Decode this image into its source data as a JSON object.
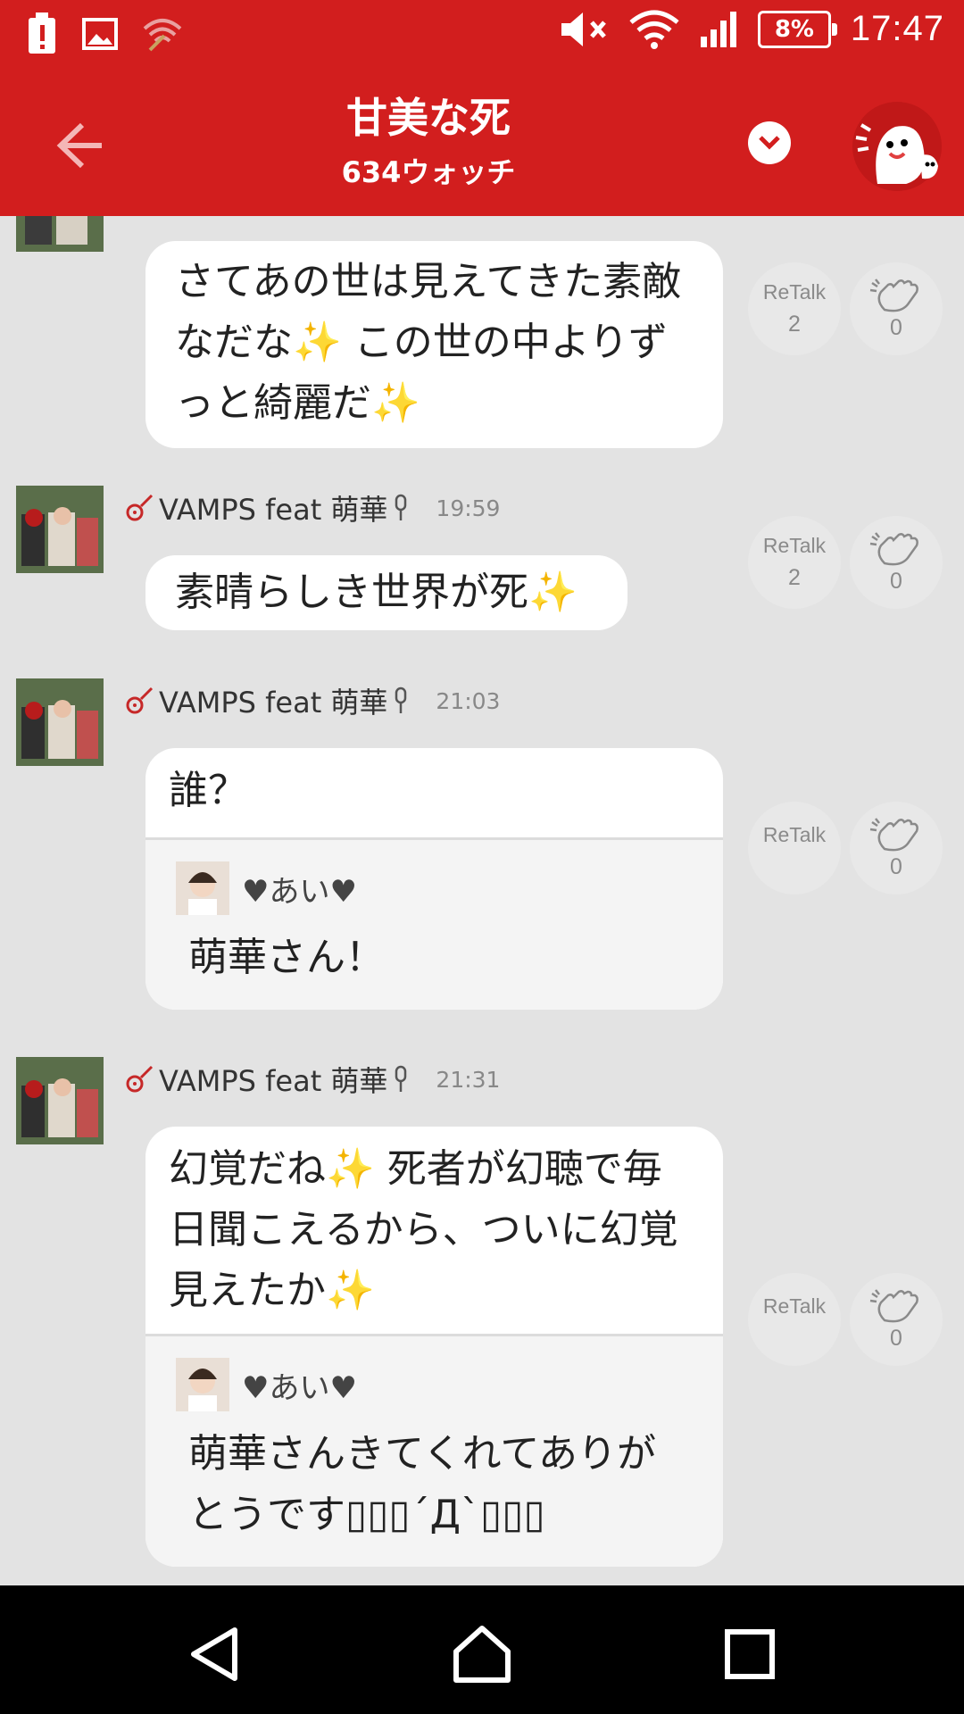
{
  "status_bar": {
    "battery": "8%",
    "time": "17:47"
  },
  "app_bar": {
    "title": "甘美な死",
    "subtitle": "634ウォッチ"
  },
  "messages": [
    {
      "sender": "",
      "time": "",
      "text": "さてあの世は見えてきた素敵なだな✨ この世の中よりずっと綺麗だ✨",
      "retalk_label": "ReTalk",
      "retalk_count": "2",
      "clap_count": "0"
    },
    {
      "sender": "VAMPS feat 萌華",
      "time": "19:59",
      "text": "素晴らしき世界が死✨",
      "retalk_label": "ReTalk",
      "retalk_count": "2",
      "clap_count": "0"
    },
    {
      "sender": "VAMPS feat 萌華",
      "time": "21:03",
      "text": "誰？",
      "quote_name": "♥あい♥",
      "quote_text": "萌華さん！",
      "retalk_label": "ReTalk",
      "clap_count": "0"
    },
    {
      "sender": "VAMPS feat 萌華",
      "time": "21:31",
      "text": "幻覚だね✨ 死者が幻聴で毎日聞こえるから、ついに幻覚見えたか✨",
      "quote_name": "♥あい♥",
      "quote_text": "萌華さんきてくれてありがとうです▯▯▯´Д`▯▯▯",
      "retalk_label": "ReTalk",
      "clap_count": "0"
    }
  ],
  "colors": {
    "brand_red": "#d21e1e",
    "chat_bg": "#e3e3e3"
  },
  "icons": {
    "status_left": [
      "alert-icon",
      "image-icon",
      "wifi-off-icon"
    ],
    "status_right": [
      "mute-icon",
      "wifi-icon",
      "signal-icon",
      "battery-icon"
    ],
    "navbar": [
      "back-triangle-icon",
      "home-icon",
      "recents-icon"
    ]
  }
}
